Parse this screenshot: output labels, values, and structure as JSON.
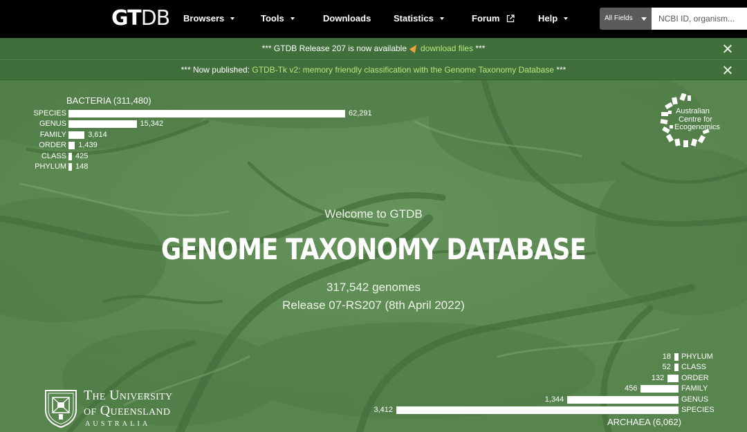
{
  "nav": {
    "logo_bold": "GT",
    "logo_light": "DB",
    "items": [
      {
        "label": "Browsers"
      },
      {
        "label": "Tools"
      },
      {
        "label": "Downloads"
      },
      {
        "label": "Statistics"
      },
      {
        "label": "Forum"
      },
      {
        "label": "Help"
      }
    ],
    "search": {
      "field_selected": "All Fields",
      "placeholder": "NCBI ID, organism..."
    }
  },
  "banners": [
    {
      "prefix": "*** GTDB Release 207 is now available",
      "link": "download files",
      "suffix": "***"
    },
    {
      "prefix": "*** Now published:",
      "link": "GTDB-Tk v2: memory friendly classification with the Genome Taxonomy Database",
      "suffix": "***"
    }
  ],
  "hero": {
    "welcome": "Welcome to GTDB",
    "title": "GENOME TAXONOMY DATABASE",
    "genomes": "317,542 genomes",
    "release": "Release 07-RS207 (8th April 2022)"
  },
  "chart_data": [
    {
      "type": "bar",
      "title": "BACTERIA (311,480)",
      "categories": [
        "SPECIES",
        "GENUS",
        "FAMILY",
        "ORDER",
        "CLASS",
        "PHYLUM"
      ],
      "values": [
        62291,
        15342,
        3614,
        1439,
        425,
        148
      ],
      "value_labels": [
        "62,291",
        "15,342",
        "3,614",
        "1,439",
        "425",
        "148"
      ]
    },
    {
      "type": "bar",
      "title": "ARCHAEA (6,062)",
      "categories": [
        "PHYLUM",
        "CLASS",
        "ORDER",
        "FAMILY",
        "GENUS",
        "SPECIES"
      ],
      "values": [
        18,
        52,
        132,
        456,
        1344,
        3412
      ],
      "value_labels": [
        "18",
        "52",
        "132",
        "456",
        "1,344",
        "3,412"
      ]
    }
  ],
  "logos": {
    "ace": [
      "Australian",
      "Centre for",
      "Ecogenomics"
    ],
    "uq_line1": "The University",
    "uq_line2": "of Queensland",
    "uq_line3": "AUSTRALIA"
  },
  "colors": {
    "navbar": "#000000",
    "banner": "#416f3c",
    "banner_link": "#b6e77b",
    "hero": "#608d56"
  },
  "icons": {
    "forum": "external-link-icon",
    "banner_close": "close-icon",
    "banner_emoji": "party-popper-icon"
  }
}
